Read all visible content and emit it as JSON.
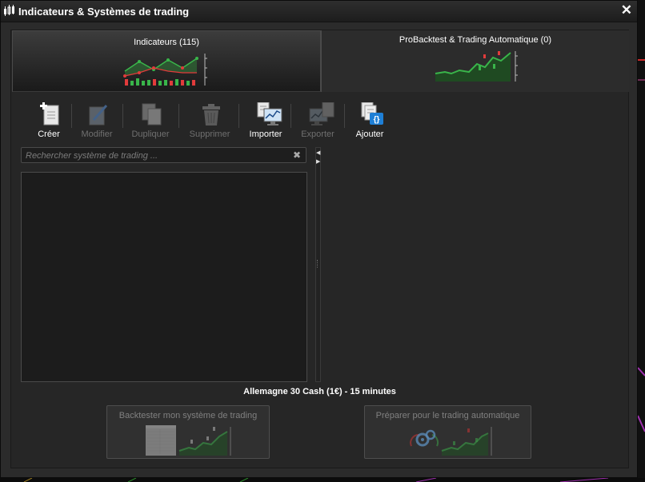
{
  "window": {
    "title": "Indicateurs & Systèmes de trading",
    "close_symbol": "✕"
  },
  "tabs": [
    {
      "label": "Indicateurs (115)",
      "selected": true
    },
    {
      "label": "ProBacktest & Trading Automatique (0)",
      "selected": false
    }
  ],
  "toolbar": {
    "create_label": "Créer",
    "modify_label": "Modifier",
    "duplicate_label": "Dupliquer",
    "delete_label": "Supprimer",
    "import_label": "Importer",
    "export_label": "Exporter",
    "add_label": "Ajouter"
  },
  "search": {
    "placeholder": "Rechercher système de trading ...",
    "value": "",
    "clear_symbol": "✖"
  },
  "splitter": {
    "collapse_symbol": "◀",
    "expand_symbol": "▶"
  },
  "market": {
    "label": "Allemagne 30 Cash (1€) - 15 minutes"
  },
  "buttons": {
    "backtest_label": "Backtester mon système de trading",
    "auto_label": "Préparer pour le trading automatique"
  },
  "colors": {
    "accent_green": "#39b54a",
    "accent_red": "#e23b3b",
    "window_bg": "#2b2b2b",
    "disabled_text": "#707070"
  }
}
